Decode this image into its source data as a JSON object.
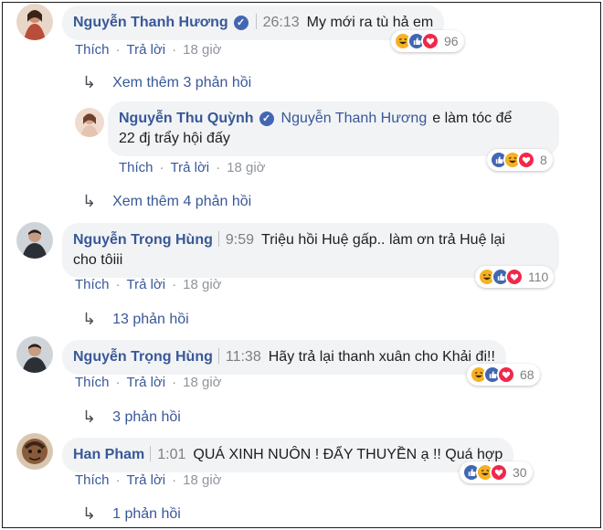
{
  "comments": [
    {
      "author": "Nguyễn Thanh Hương",
      "verified": true,
      "timestamp": "26:13",
      "text": "My mới ra tù hả em",
      "react_count": "96",
      "reactions": [
        "haha",
        "like",
        "love"
      ],
      "actions": {
        "like": "Thích",
        "reply": "Trả lời",
        "time": "18 giờ"
      }
    },
    {
      "author": "Nguyễn Thu Quỳnh",
      "verified": true,
      "mention": "Nguyễn Thanh Hương",
      "text_line1": "e làm tóc để",
      "text_line2": "22 đj trẩy hội đấy",
      "react_count": "8",
      "reactions": [
        "like",
        "haha",
        "love"
      ],
      "actions": {
        "like": "Thích",
        "reply": "Trả lời",
        "time": "18 giờ"
      }
    },
    {
      "author": "Nguyễn Trọng Hùng",
      "timestamp": "9:59",
      "text_line1": "Triệu hồi Huệ gấp.. làm ơn trả Huệ lại",
      "text_line2": "cho tôiii",
      "react_count": "110",
      "reactions": [
        "haha",
        "like",
        "love"
      ],
      "actions": {
        "like": "Thích",
        "reply": "Trả lời",
        "time": "18 giờ"
      }
    },
    {
      "author": "Nguyễn Trọng Hùng",
      "timestamp": "11:38",
      "text": "Hãy trả lại thanh xuân cho Khải đi!!",
      "react_count": "68",
      "reactions": [
        "haha",
        "like",
        "love"
      ],
      "actions": {
        "like": "Thích",
        "reply": "Trả lời",
        "time": "18 giờ"
      }
    },
    {
      "author": "Han Pham",
      "timestamp": "1:01",
      "text": "QUÁ XINH NUÔN ! ĐẨY THUYỀN ạ !! Quá hợp",
      "react_count": "30",
      "reactions": [
        "like",
        "haha",
        "love"
      ],
      "actions": {
        "like": "Thích",
        "reply": "Trả lời",
        "time": "18 giờ"
      }
    }
  ],
  "more_replies": [
    "Xem thêm 3 phản hồi",
    "Xem thêm 4 phản hồi",
    "13 phản hồi",
    "3 phản hồi",
    "1 phản hồi"
  ],
  "colors": {
    "author": "#385898",
    "like": "#4267b2",
    "love": "#f0284a",
    "haha": "#f7b125",
    "bubble": "#f2f3f5"
  },
  "icons": {
    "arrow": "reply-arrow-icon",
    "verified": "verified-badge-icon"
  }
}
